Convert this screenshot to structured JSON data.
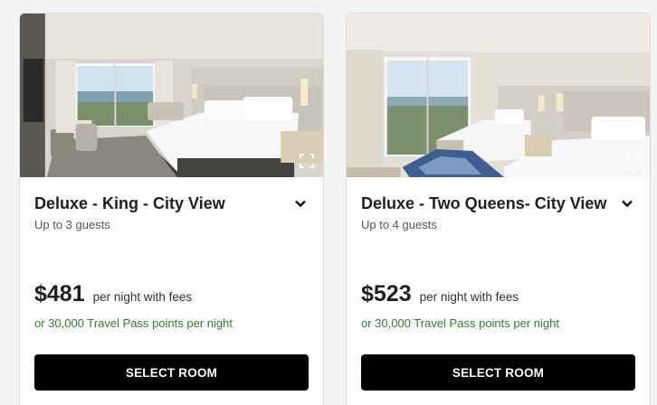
{
  "rooms": [
    {
      "name": "Deluxe - King - City View",
      "guests": "Up to 3 guests",
      "price": "$481",
      "price_note": "per night with fees",
      "points": "or 30,000 Travel Pass points per night",
      "button": "SELECT ROOM"
    },
    {
      "name": "Deluxe - Two Queens- City View",
      "guests": "Up to 4 guests",
      "price": "$523",
      "price_note": "per night with fees",
      "points": "or 30,000 Travel Pass points per night",
      "button": "SELECT ROOM"
    }
  ],
  "colors": {
    "points_text": "#2e7d32",
    "button_bg": "#000000",
    "button_text": "#ffffff"
  },
  "icons": {
    "expand": "expand-fullscreen-icon",
    "chevron": "chevron-down-icon"
  }
}
